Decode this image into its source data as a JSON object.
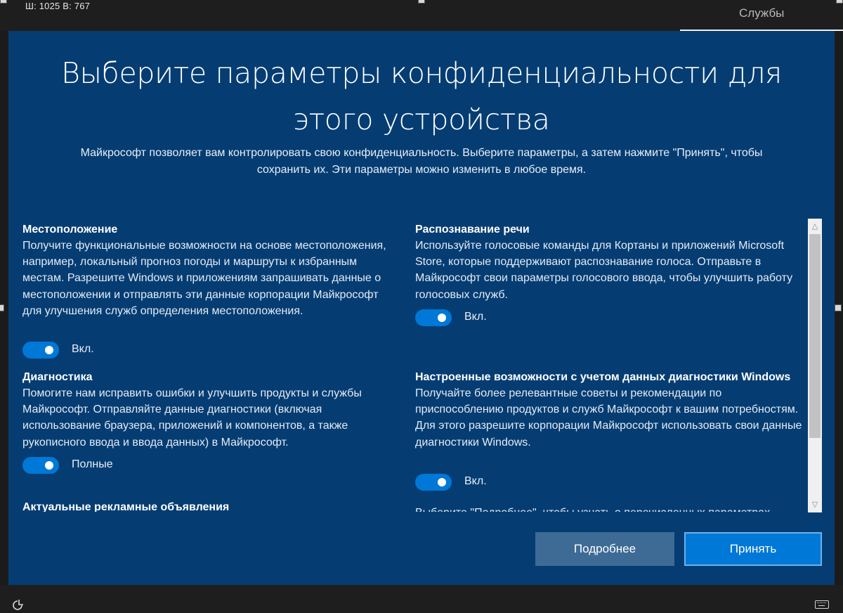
{
  "topbar": {
    "dimensions_label": "Ш: 1025 В: 767",
    "services_tab": "Службы"
  },
  "header": {
    "title_line1": "Выберите параметры конфиденциальности для",
    "title_line2": "этого устройства",
    "subtitle_line1": "Майкрософт позволяет вам контролировать свою конфиденциальность. Выберите параметры, а затем нажмите \"Принять\", чтобы",
    "subtitle_line2": "сохранить их. Эти параметры можно изменить в любое время."
  },
  "sections": {
    "location": {
      "title": "Местоположение",
      "body": "Получите функциональные возможности на основе местоположения, например, локальный прогноз погоды и маршруты к избранным местам. Разрешите Windows и приложениям запрашивать данные о местоположении и отправлять эти данные корпорации Майкрософт для улучшения служб определения местоположения.",
      "toggle_label": "Вкл.",
      "toggle_on": true
    },
    "speech": {
      "title": "Распознавание речи",
      "body": "Используйте голосовые команды для Кортаны и приложений Microsoft Store, которые поддерживают распознавание голоса. Отправьте в Майкрософт свои параметры голосового ввода, чтобы улучшить работу голосовых служб.",
      "toggle_label": "Вкл.",
      "toggle_on": true
    },
    "diagnostics": {
      "title": "Диагностика",
      "body": "Помогите нам исправить ошибки и улучшить продукты и службы Майкрософт. Отправляйте данные диагностики (включая использование браузера, приложений и компонентов, а также рукописного ввода и ввода данных) в Майкрософт.",
      "toggle_label": "Полные",
      "toggle_on": true
    },
    "tailored": {
      "title": "Настроенные возможности с учетом данных диагностики Windows",
      "body": "Получайте более релевантные советы и рекомендации по приспособлению продуктов и служб Майкрософт к вашим потребностям. Для этого разрешите корпорации Майкрософт использовать свои данные диагностики Windows.",
      "toggle_label": "Вкл.",
      "toggle_on": true
    },
    "ads": {
      "title": "Актуальные рекламные объявления"
    },
    "more_info_text": "Выберите \"Подробнее\", чтобы узнать о перечисленных параметрах"
  },
  "buttons": {
    "more": "Подробнее",
    "accept": "Принять"
  },
  "colors": {
    "background": "#053d73",
    "toggle_on": "#0078d7",
    "secondary_button": "#3e6b96",
    "primary_button": "#0078d7"
  },
  "icons": {
    "bottom_left": "accessibility-icon",
    "bottom_right": "keyboard-icon",
    "scroll_up": "chevron-up-icon",
    "scroll_down": "chevron-down-icon"
  }
}
